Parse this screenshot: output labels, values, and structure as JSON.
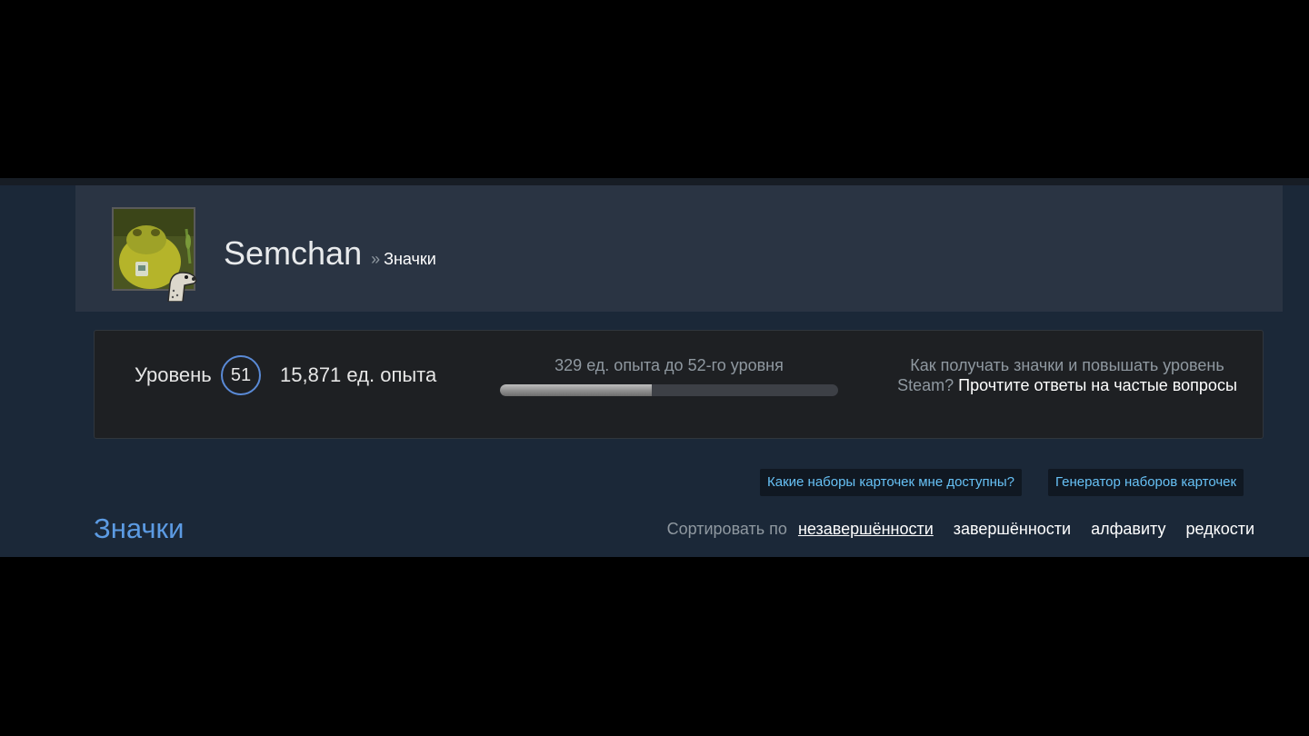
{
  "profile": {
    "persona_name": "Semchan",
    "breadcrumb_separator": "»",
    "breadcrumb_page": "Значки"
  },
  "level": {
    "label": "Уровень",
    "value": "51",
    "xp_total": "15,871 ед. опыта",
    "xp_to_next": "329 ед. опыта до 52-го уровня",
    "progress_fraction": 0.45,
    "faq_text": "Как получать значки и повышать уровень Steam?",
    "faq_link": "Прочтите ответы на частые вопросы"
  },
  "actions": {
    "card_sets_label": "Какие наборы карточек мне доступны?",
    "set_generator_label": "Генератор наборов карточек"
  },
  "badges": {
    "title": "Значки",
    "sort_label": "Сортировать по",
    "sort_options": [
      "незавершённости",
      "завершённости",
      "алфавиту",
      "редкости"
    ],
    "sort_active": "незавершённости"
  },
  "colors": {
    "page_bg": "#1b2838",
    "header_bg": "#2a3443",
    "level_box_bg": "#1e2023",
    "level_ring": "#5a8ad6",
    "link_blue": "#67c1f5",
    "title_blue": "#5c9be3",
    "muted_text": "#8f98a0"
  },
  "icons": {
    "avatar": "toad-avatar-image",
    "avatar_badge": "mole-character-icon"
  }
}
